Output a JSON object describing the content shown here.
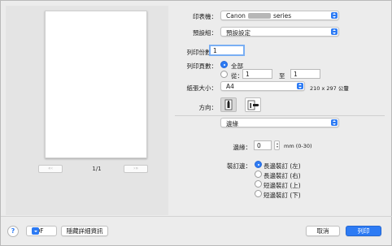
{
  "preview": {
    "page_indicator": "1/1",
    "first_label": "«‹",
    "last_label": "›»"
  },
  "printer": {
    "label": "印表機：",
    "value_prefix": "Canon",
    "value_suffix": "series"
  },
  "presets": {
    "label": "預設組：",
    "value": "預設設定"
  },
  "copies": {
    "label": "列印份數：",
    "value": "1"
  },
  "pages": {
    "label": "列印頁數：",
    "all_label": "全部",
    "from_label": "從：",
    "from_value": "1",
    "to_label": "至",
    "to_value": "1"
  },
  "paper_size": {
    "label": "紙張大小：",
    "value": "A4",
    "dimensions": "210 x 297 公釐"
  },
  "orientation": {
    "label": "方向："
  },
  "section_select": {
    "value": "邊緣"
  },
  "margin": {
    "label": "邊緣：",
    "value": "0",
    "unit_hint": "mm (0-30)"
  },
  "binding": {
    "label": "裝訂邊：",
    "options": [
      "長邊裝訂 (左)",
      "長邊裝訂 (右)",
      "短邊裝訂 (上)",
      "短邊裝訂 (下)"
    ],
    "selected_index": 0
  },
  "footer": {
    "help_label": "?",
    "pdf_label": "PDF",
    "hide_details_label": "隱藏詳細資訊",
    "cancel_label": "取消",
    "print_label": "列印"
  },
  "colors": {
    "accent": "#2d7bf4",
    "background": "#ececec"
  }
}
